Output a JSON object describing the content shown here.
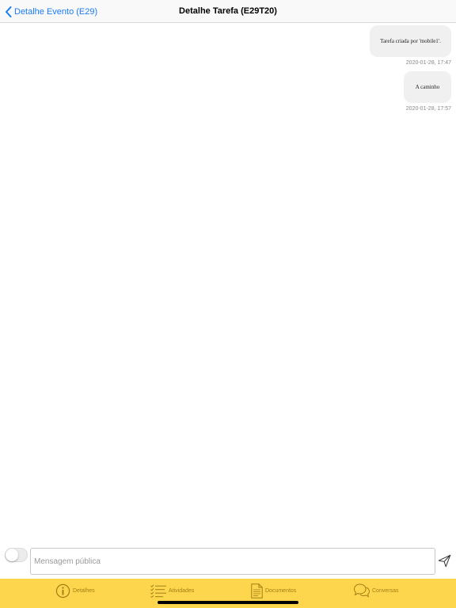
{
  "navbar": {
    "back_label": "Detalhe Evento (E29)",
    "title": "Detalhe Tarefa (E29T20)"
  },
  "messages": [
    {
      "text": "Tarefa criada por 'mobile1'.",
      "time": "2020-01-28, 17:47"
    },
    {
      "text": "A caminho",
      "time": "2020-01-28, 17:57"
    }
  ],
  "composer": {
    "placeholder": "Mensagem pública",
    "value": "",
    "public_toggle_on": false
  },
  "tabs": [
    {
      "label": "Detalhes",
      "icon": "info-icon"
    },
    {
      "label": "Atividades",
      "icon": "checklist-icon"
    },
    {
      "label": "Documentos",
      "icon": "document-icon"
    },
    {
      "label": "Conversas",
      "icon": "chat-bubbles-icon"
    }
  ],
  "colors": {
    "accent": "#1a7cf5",
    "tabbar": "#fed64d",
    "tab_label": "#a07f15"
  }
}
